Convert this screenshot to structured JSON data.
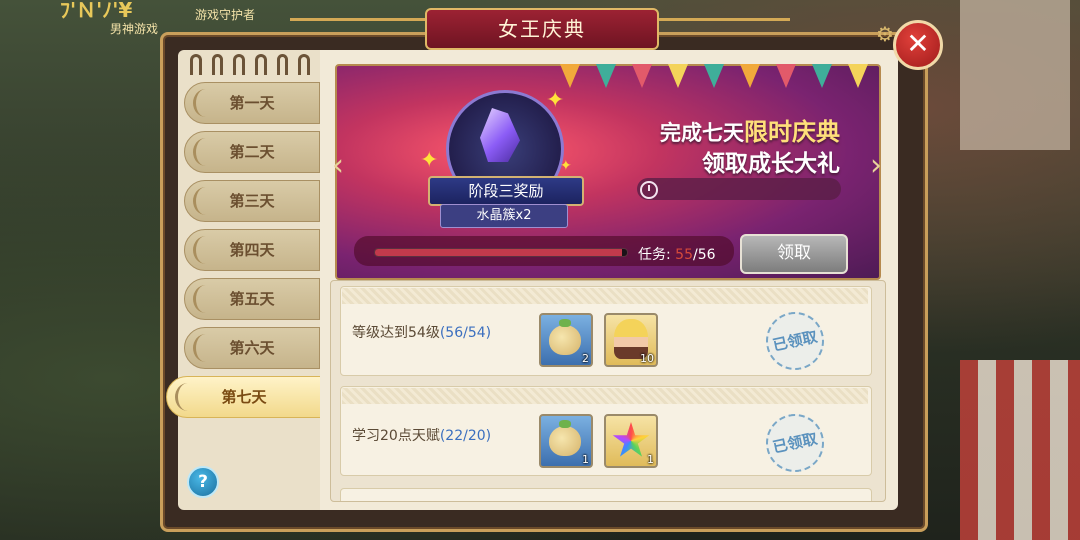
{
  "window": {
    "title": "女王庆典",
    "close_label": "✕"
  },
  "background": {
    "sign": "ﾌ'Ｎ'ﾉ'¥",
    "text1": "男神游戏",
    "text2": "游戏守护者"
  },
  "days": [
    {
      "label": "第一天",
      "active": false
    },
    {
      "label": "第二天",
      "active": false
    },
    {
      "label": "第三天",
      "active": false
    },
    {
      "label": "第四天",
      "active": false
    },
    {
      "label": "第五天",
      "active": false
    },
    {
      "label": "第六天",
      "active": false
    },
    {
      "label": "第七天",
      "active": true
    }
  ],
  "help_label": "?",
  "banner": {
    "stage_label": "阶段三奖励",
    "stage_reward": "水晶簇x2",
    "headline_prefix": "完成七天",
    "headline_highlight": "限时庆典",
    "headline_line2": "领取成长大礼",
    "task_label": "任务:",
    "task_current": "55",
    "task_total": "/56",
    "task_progress": 0.98,
    "claim_label": "领取",
    "prev_arrow": "‹",
    "next_arrow": "›"
  },
  "tasks": [
    {
      "name": "等级达到54级",
      "progress": "(56/54)",
      "rewards": [
        {
          "icon": "bag-icon",
          "qty": "2"
        },
        {
          "icon": "hero-portrait-icon",
          "qty": "10"
        }
      ],
      "stamp": "已领取"
    },
    {
      "name": "学习20点天赋",
      "progress": "(22/20)",
      "rewards": [
        {
          "icon": "bag-icon",
          "qty": "1"
        },
        {
          "icon": "rainbow-star-icon",
          "qty": "1"
        }
      ],
      "stamp": "已领取"
    }
  ],
  "colors": {
    "accent": "#9c2233",
    "frame": "#c99f5b",
    "progress_text": "#3b6fbf"
  }
}
